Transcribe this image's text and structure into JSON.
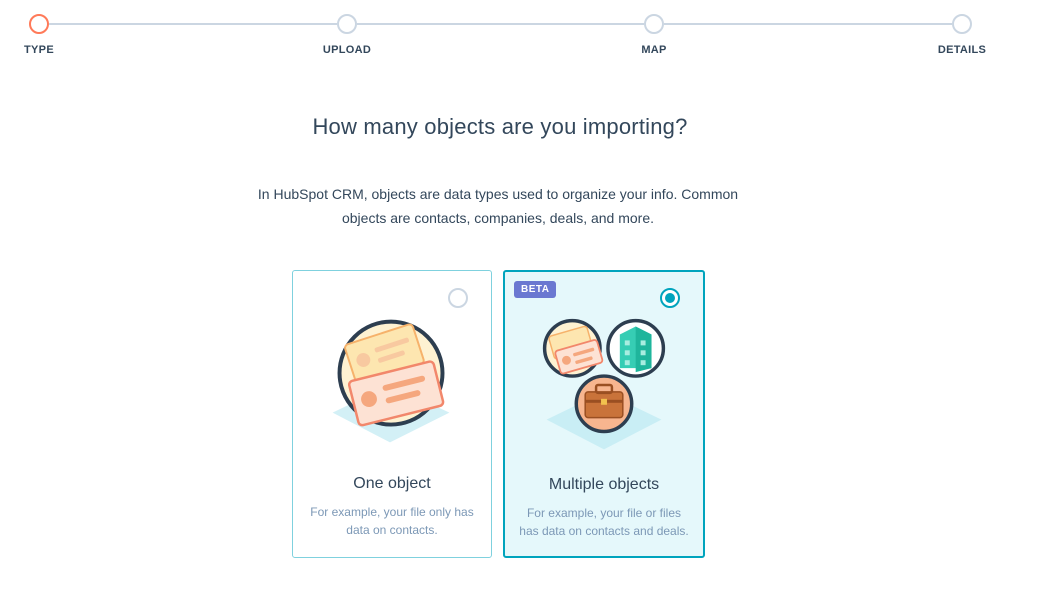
{
  "stepper": {
    "steps": [
      {
        "label": "TYPE",
        "state": "active"
      },
      {
        "label": "UPLOAD",
        "state": "pending"
      },
      {
        "label": "MAP",
        "state": "pending"
      },
      {
        "label": "DETAILS",
        "state": "pending"
      }
    ]
  },
  "main": {
    "title": "How many objects are you importing?",
    "description": "In HubSpot CRM, objects are data types used to organize your info. Common objects are contacts, companies, deals, and more."
  },
  "options": {
    "one": {
      "title": "One object",
      "description": "For example, your file only has data on contacts.",
      "selected": false,
      "icon": "contact-card-icon"
    },
    "multiple": {
      "badge": "BETA",
      "title": "Multiple objects",
      "description": "For example, your file or files has data on contacts and deals.",
      "selected": true,
      "icons": [
        "contact-card-icon",
        "company-building-icon",
        "deal-briefcase-icon"
      ]
    }
  },
  "colors": {
    "active_step": "#ff7a59",
    "selected_border": "#00a4bd",
    "beta_badge": "#6a78d1"
  }
}
